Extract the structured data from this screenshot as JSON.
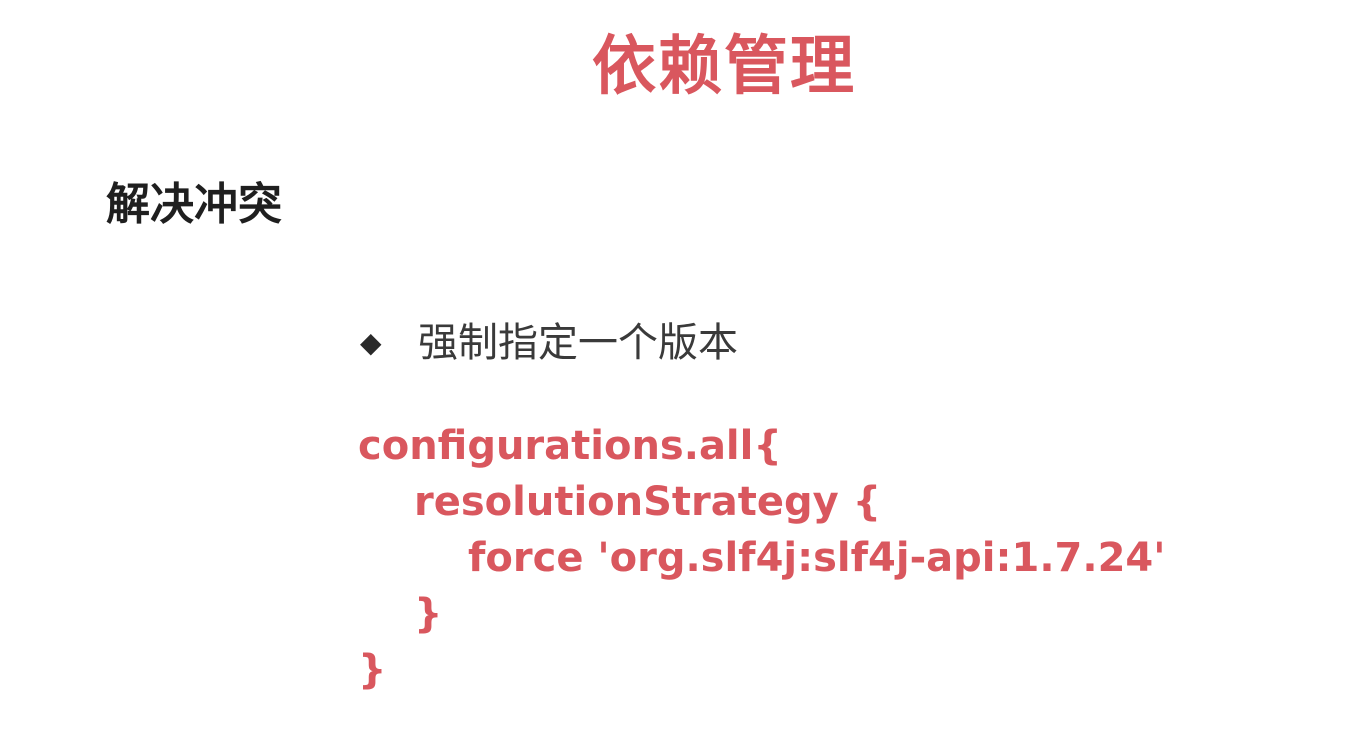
{
  "slide": {
    "title": "依赖管理",
    "section_heading": "解决冲突",
    "bullet": {
      "icon": "diamond-bullet-icon",
      "marker": "◆",
      "text": "强制指定一个版本"
    },
    "code": {
      "lines": [
        "configurations.all{",
        "resolutionStrategy {",
        "force 'org.slf4j:slf4j-api:1.7.24'",
        "}",
        "}"
      ]
    },
    "colors": {
      "accent": "#d9575e",
      "heading": "#1f1f1f",
      "body_text": "#3a3a3a",
      "background": "#ffffff"
    }
  }
}
